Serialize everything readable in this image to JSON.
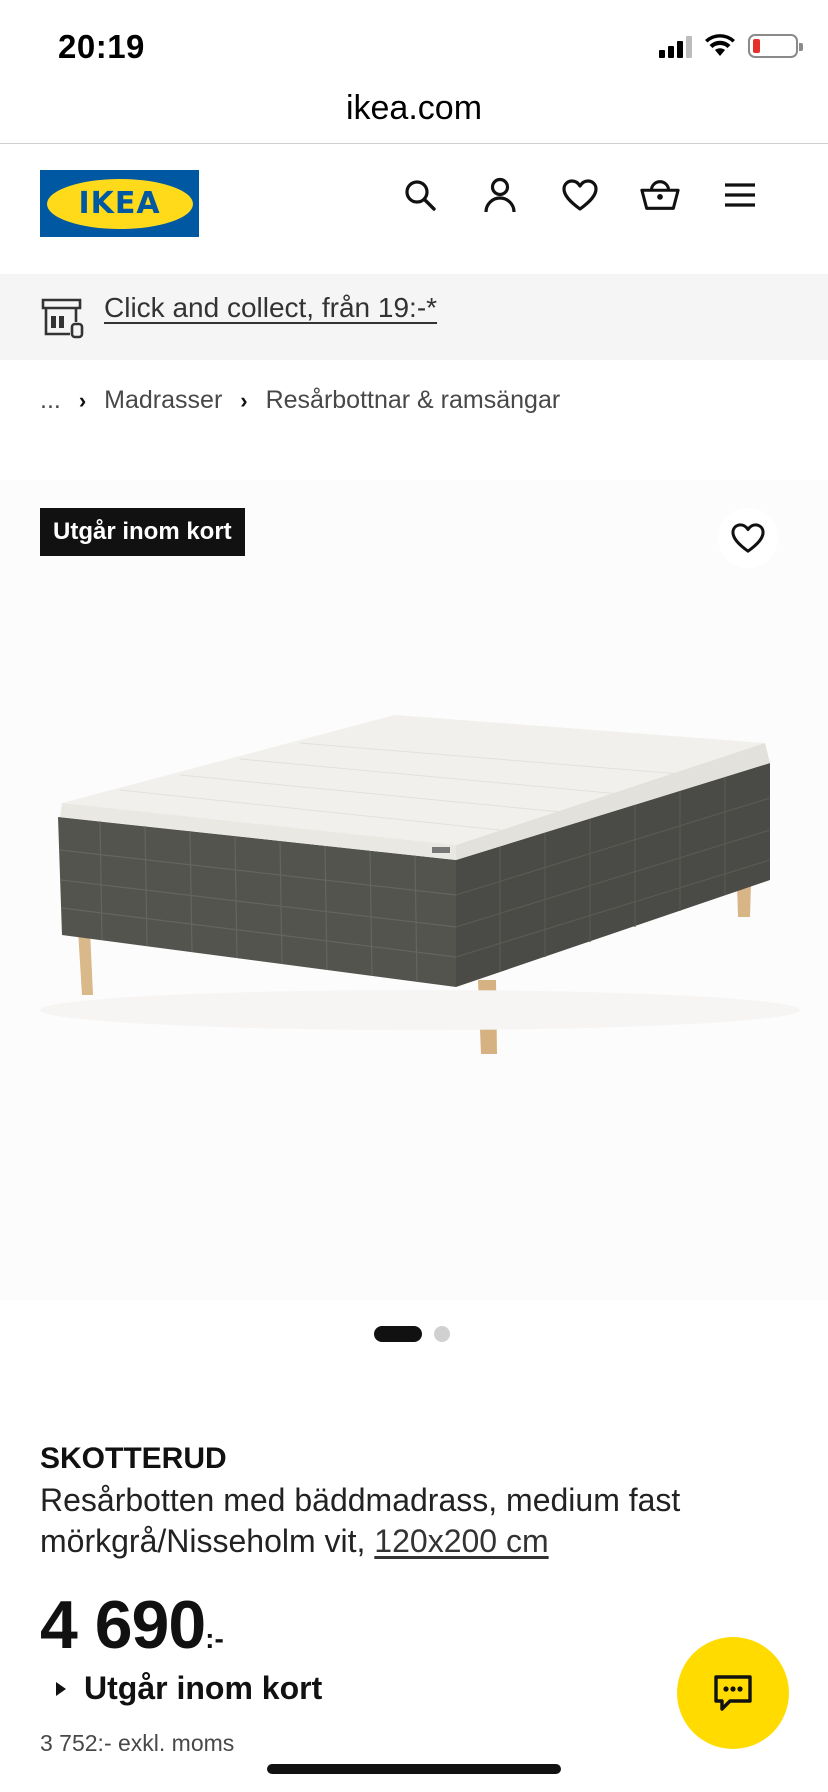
{
  "status_bar": {
    "time": "20:19",
    "battery_color": "#e5312c"
  },
  "browser": {
    "url": "ikea.com"
  },
  "header": {
    "logo_text": "IKEA",
    "brand_blue": "#0058a3",
    "brand_yellow": "#ffda1a",
    "icons": [
      "search-icon",
      "profile-icon",
      "heart-icon",
      "basket-icon",
      "menu-icon"
    ]
  },
  "banner": {
    "collect_text": "Click and collect, från 19:-*"
  },
  "breadcrumb": {
    "ellipsis": "...",
    "items": [
      "Madrasser",
      "Resårbottnar & ramsängar"
    ]
  },
  "product_image": {
    "badge": "Utgår inom kort",
    "carousel_count": 2,
    "carousel_active": 1
  },
  "product": {
    "name": "SKOTTERUD",
    "description": "Resårbotten med bäddmadrass, medium fast mörkgrå/Nisseholm vit, ",
    "size": "120x200 cm",
    "price": "4 690",
    "price_suffix": ":-",
    "availability": "Utgår inom kort",
    "price_excl_vat": "3 752:- exkl. moms"
  },
  "chat": {
    "color": "#ffdb00"
  }
}
